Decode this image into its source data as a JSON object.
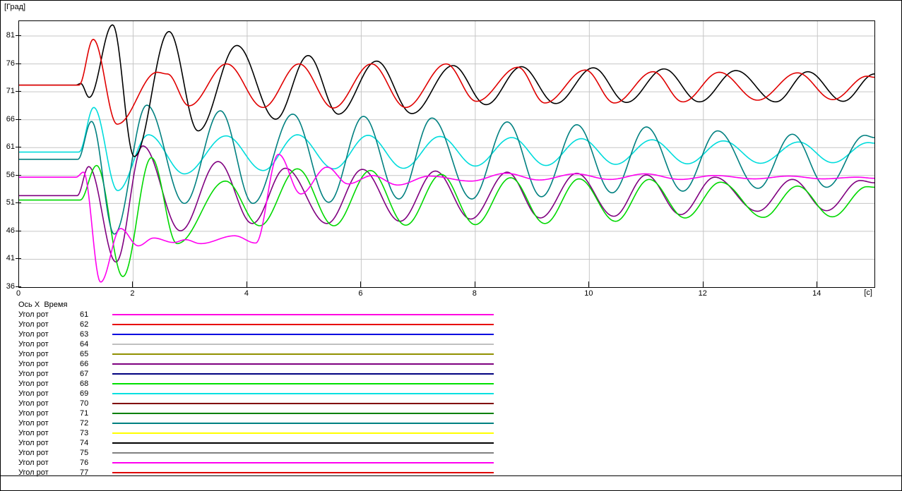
{
  "window_title": "",
  "plot": {
    "y_axis_label": "[Град]",
    "x_axis_unit": "[c]",
    "y_ticks": [
      81,
      76,
      71,
      66,
      61,
      56,
      51,
      46,
      41,
      36
    ],
    "x_ticks": [
      0,
      2,
      4,
      6,
      8,
      10,
      12,
      14
    ],
    "grid_color": "#c6c6c6",
    "axis_color": "#000000",
    "background": "#ffffff"
  },
  "legend": {
    "header": {
      "axis_label": "Ось X",
      "axis_value": "Время"
    },
    "items": [
      {
        "label": "Угол рот",
        "num": "61",
        "color": "#ff00e0"
      },
      {
        "label": "Угол рот",
        "num": "62",
        "color": "#e80000"
      },
      {
        "label": "Угол рот",
        "num": "63",
        "color": "#0000e0"
      },
      {
        "label": "Угол рот",
        "num": "64",
        "color": "#c0c0c0"
      },
      {
        "label": "Угол рот",
        "num": "65",
        "color": "#909000"
      },
      {
        "label": "Угол рот",
        "num": "66",
        "color": "#800080"
      },
      {
        "label": "Угол рот",
        "num": "67",
        "color": "#000080"
      },
      {
        "label": "Угол рот",
        "num": "68",
        "color": "#00e000"
      },
      {
        "label": "Угол рот",
        "num": "69",
        "color": "#00e0e0"
      },
      {
        "label": "Угол рот",
        "num": "70",
        "color": "#800000"
      },
      {
        "label": "Угол рот",
        "num": "71",
        "color": "#008000"
      },
      {
        "label": "Угол рот",
        "num": "72",
        "color": "#008080"
      },
      {
        "label": "Угол рот",
        "num": "73",
        "color": "#ffff00"
      },
      {
        "label": "Угол рот",
        "num": "74",
        "color": "#000000"
      },
      {
        "label": "Угол рот",
        "num": "75",
        "color": "#808080"
      },
      {
        "label": "Угол рот",
        "num": "76",
        "color": "#ff00f0"
      },
      {
        "label": "Угол рот",
        "num": "77",
        "color": "#e00000"
      }
    ]
  },
  "chart_data": {
    "type": "line",
    "title": "",
    "xlabel": "Время",
    "x_unit": "c",
    "ylabel": "Град",
    "xlim": [
      0,
      15
    ],
    "ylim": [
      36,
      83.66
    ],
    "grid": true,
    "legend_position": "bottom",
    "note": "Rotor angle swing curves; keyframes are [t_seconds, value_degrees] at successive extrema; curve is smooth (cosine) between extrema. Visible distinct trajectories (several of the 17 legend entries coincide).",
    "series": [
      {
        "name": "rotor-angle-purple",
        "color": "#800080",
        "keyframes": [
          [
            0,
            52.4
          ],
          [
            1.02,
            52.4
          ],
          [
            1.22,
            57.6
          ],
          [
            1.7,
            40.5
          ],
          [
            2.17,
            61.3
          ],
          [
            2.83,
            46.1
          ],
          [
            3.49,
            58.5
          ],
          [
            4.09,
            47.4
          ],
          [
            4.67,
            57.3
          ],
          [
            5.4,
            47.4
          ],
          [
            6.02,
            57.1
          ],
          [
            6.68,
            47.8
          ],
          [
            7.3,
            56.8
          ],
          [
            7.92,
            48.2
          ],
          [
            8.56,
            56.6
          ],
          [
            9.14,
            48.4
          ],
          [
            9.78,
            56.4
          ],
          [
            10.43,
            48.7
          ],
          [
            11.0,
            56.1
          ],
          [
            11.6,
            49.0
          ],
          [
            12.2,
            55.7
          ],
          [
            12.95,
            49.6
          ],
          [
            13.56,
            55.3
          ],
          [
            14.16,
            49.7
          ],
          [
            14.75,
            55.1
          ],
          [
            15,
            54.7
          ]
        ]
      },
      {
        "name": "rotor-angle-green",
        "color": "#00d800",
        "keyframes": [
          [
            0,
            51.6
          ],
          [
            1.07,
            51.6
          ],
          [
            1.36,
            57.8
          ],
          [
            1.82,
            37.9
          ],
          [
            2.32,
            59.2
          ],
          [
            2.77,
            43.8
          ],
          [
            3.62,
            55.0
          ],
          [
            4.22,
            47.0
          ],
          [
            4.88,
            57.2
          ],
          [
            5.52,
            47.0
          ],
          [
            6.16,
            56.9
          ],
          [
            6.78,
            47.1
          ],
          [
            7.4,
            56.2
          ],
          [
            8.0,
            47.2
          ],
          [
            8.62,
            55.6
          ],
          [
            9.22,
            47.4
          ],
          [
            9.82,
            55.4
          ],
          [
            10.46,
            47.8
          ],
          [
            11.05,
            55.3
          ],
          [
            11.68,
            48.4
          ],
          [
            12.3,
            54.8
          ],
          [
            13.05,
            48.5
          ],
          [
            13.65,
            54.1
          ],
          [
            14.26,
            48.6
          ],
          [
            14.87,
            54.0
          ],
          [
            15,
            53.9
          ]
        ]
      },
      {
        "name": "rotor-angle-cyan",
        "color": "#00dcdc",
        "keyframes": [
          [
            0,
            60.2
          ],
          [
            1.05,
            60.2
          ],
          [
            1.31,
            68.2
          ],
          [
            1.73,
            53.3
          ],
          [
            2.27,
            63.3
          ],
          [
            2.9,
            56.3
          ],
          [
            3.63,
            63.1
          ],
          [
            4.28,
            56.9
          ],
          [
            4.88,
            63.3
          ],
          [
            5.52,
            57.2
          ],
          [
            6.12,
            63.2
          ],
          [
            6.74,
            57.3
          ],
          [
            7.38,
            63.0
          ],
          [
            8.0,
            57.7
          ],
          [
            8.64,
            62.8
          ],
          [
            9.24,
            57.8
          ],
          [
            9.86,
            62.6
          ],
          [
            10.46,
            58.0
          ],
          [
            11.1,
            62.4
          ],
          [
            11.72,
            58.1
          ],
          [
            12.35,
            62.2
          ],
          [
            13.0,
            58.2
          ],
          [
            13.67,
            62.0
          ],
          [
            14.27,
            58.3
          ],
          [
            14.89,
            61.9
          ],
          [
            15,
            61.8
          ]
        ]
      },
      {
        "name": "rotor-angle-teal",
        "color": "#008080",
        "keyframes": [
          [
            0,
            58.9
          ],
          [
            1.03,
            58.9
          ],
          [
            1.27,
            65.7
          ],
          [
            1.67,
            45.5
          ],
          [
            2.24,
            68.6
          ],
          [
            2.9,
            51.0
          ],
          [
            3.53,
            67.6
          ],
          [
            4.1,
            51.0
          ],
          [
            4.8,
            67.0
          ],
          [
            5.43,
            51.2
          ],
          [
            6.04,
            66.6
          ],
          [
            6.66,
            51.8
          ],
          [
            7.24,
            66.3
          ],
          [
            7.94,
            51.8
          ],
          [
            8.56,
            65.6
          ],
          [
            9.16,
            52.2
          ],
          [
            9.78,
            65.1
          ],
          [
            10.4,
            52.9
          ],
          [
            11.0,
            64.7
          ],
          [
            11.64,
            53.2
          ],
          [
            12.25,
            64.0
          ],
          [
            12.96,
            53.7
          ],
          [
            13.56,
            63.4
          ],
          [
            14.16,
            53.9
          ],
          [
            14.83,
            63.2
          ],
          [
            15,
            62.8
          ]
        ]
      },
      {
        "name": "rotor-angle-black",
        "color": "#000000",
        "keyframes": [
          [
            0,
            72.2
          ],
          [
            1.0,
            72.2
          ],
          [
            1.08,
            72.5
          ],
          [
            1.23,
            70.0
          ],
          [
            1.64,
            83.0
          ],
          [
            2.02,
            59.4
          ],
          [
            2.63,
            81.8
          ],
          [
            3.14,
            64.0
          ],
          [
            3.82,
            79.3
          ],
          [
            4.5,
            66.1
          ],
          [
            5.07,
            77.5
          ],
          [
            5.6,
            67.0
          ],
          [
            6.27,
            76.5
          ],
          [
            6.89,
            67.1
          ],
          [
            7.61,
            75.7
          ],
          [
            8.19,
            68.7
          ],
          [
            8.81,
            75.5
          ],
          [
            9.41,
            68.9
          ],
          [
            10.07,
            75.3
          ],
          [
            10.65,
            69.1
          ],
          [
            11.31,
            75.1
          ],
          [
            11.93,
            69.2
          ],
          [
            12.57,
            74.8
          ],
          [
            13.27,
            69.2
          ],
          [
            13.83,
            74.6
          ],
          [
            14.45,
            69.3
          ],
          [
            15,
            74.2
          ]
        ]
      },
      {
        "name": "rotor-angle-magenta",
        "color": "#ff00f0",
        "keyframes": [
          [
            0,
            55.7
          ],
          [
            1.0,
            55.7
          ],
          [
            1.13,
            56.6
          ],
          [
            1.43,
            36.9
          ],
          [
            1.78,
            46.5
          ],
          [
            2.09,
            43.4
          ],
          [
            2.36,
            44.8
          ],
          [
            2.71,
            44.0
          ],
          [
            2.92,
            44.5
          ],
          [
            3.18,
            43.8
          ],
          [
            3.78,
            45.2
          ],
          [
            4.15,
            43.9
          ],
          [
            4.55,
            59.8
          ],
          [
            4.94,
            52.7
          ],
          [
            5.4,
            57.5
          ],
          [
            5.77,
            54.5
          ],
          [
            6.2,
            56.0
          ],
          [
            6.64,
            54.3
          ],
          [
            7.2,
            55.9
          ],
          [
            7.92,
            55.0
          ],
          [
            8.54,
            56.4
          ],
          [
            9.12,
            55.2
          ],
          [
            9.76,
            56.3
          ],
          [
            10.36,
            55.3
          ],
          [
            10.98,
            56.3
          ],
          [
            11.6,
            55.3
          ],
          [
            12.2,
            56.0
          ],
          [
            12.9,
            55.4
          ],
          [
            13.5,
            55.9
          ],
          [
            14.1,
            55.4
          ],
          [
            14.7,
            55.7
          ],
          [
            15,
            55.5
          ]
        ]
      },
      {
        "name": "rotor-angle-red",
        "color": "#e00000",
        "keyframes": [
          [
            0,
            72.2
          ],
          [
            1.05,
            72.2
          ],
          [
            1.3,
            80.4
          ],
          [
            1.72,
            65.2
          ],
          [
            2.42,
            74.5
          ],
          [
            2.6,
            74.2
          ],
          [
            2.98,
            68.5
          ],
          [
            3.64,
            76.0
          ],
          [
            4.28,
            68.2
          ],
          [
            4.91,
            76.0
          ],
          [
            5.51,
            68.1
          ],
          [
            6.18,
            76.0
          ],
          [
            6.78,
            68.2
          ],
          [
            7.49,
            76.0
          ],
          [
            8.02,
            69.3
          ],
          [
            8.75,
            75.4
          ],
          [
            9.22,
            69.0
          ],
          [
            9.93,
            74.9
          ],
          [
            10.44,
            69.0
          ],
          [
            11.12,
            74.6
          ],
          [
            11.64,
            69.2
          ],
          [
            12.28,
            74.5
          ],
          [
            12.95,
            69.5
          ],
          [
            13.65,
            74.4
          ],
          [
            14.27,
            69.6
          ],
          [
            14.87,
            73.8
          ],
          [
            15,
            73.6
          ]
        ]
      }
    ]
  }
}
